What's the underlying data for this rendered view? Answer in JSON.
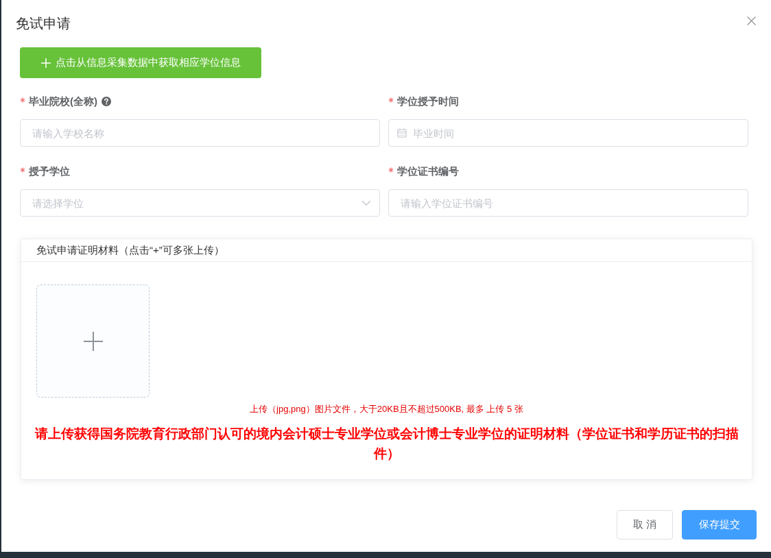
{
  "dialog": {
    "title": "免试申请"
  },
  "fetch_button": {
    "label": "点击从信息采集数据中获取相应学位信息"
  },
  "fields": [
    {
      "label": "毕业院校(全称)",
      "required": true,
      "help": true,
      "kind": "text",
      "placeholder": "请输入学校名称"
    },
    {
      "label": "学位授予时间",
      "required": true,
      "kind": "date",
      "placeholder": "毕业时间"
    },
    {
      "label": "授予学位",
      "required": true,
      "kind": "select",
      "placeholder": "请选择学位"
    },
    {
      "label": "学位证书编号",
      "required": true,
      "kind": "text",
      "placeholder": "请输入学位证书编号"
    }
  ],
  "upload_card": {
    "title": "免试申请证明材料（点击“+”可多张上传）",
    "hint": "上传（jpg,png）图片文件，大于20KB且不超过500KB, 最多 上传 5 张",
    "notice": "请上传获得国务院教育行政部门认可的境内会计硕士专业学位或会计博士专业学位的证明材料（学位证书和学历证书的扫描件）"
  },
  "buttons": [
    {
      "label": "取 消",
      "kind": "default"
    },
    {
      "label": "保存提交",
      "kind": "primary"
    }
  ]
}
